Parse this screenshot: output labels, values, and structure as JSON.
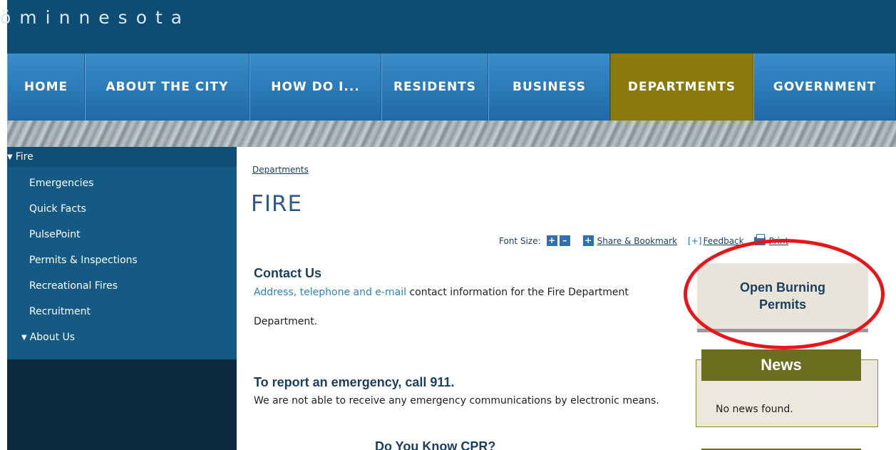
{
  "header": {
    "brand": "minnesota",
    "brand_prefix": "ö"
  },
  "nav": {
    "items": [
      {
        "label": "HOME"
      },
      {
        "label": "ABOUT THE CITY"
      },
      {
        "label": "HOW DO I..."
      },
      {
        "label": "RESIDENTS"
      },
      {
        "label": "BUSINESS"
      },
      {
        "label": "DEPARTMENTS"
      },
      {
        "label": "GOVERNMENT"
      }
    ],
    "active": "DEPARTMENTS"
  },
  "sidebar": {
    "header": "Fire",
    "items": [
      {
        "label": "Emergencies"
      },
      {
        "label": "Quick Facts"
      },
      {
        "label": "PulsePoint"
      },
      {
        "label": "Permits & Inspections"
      },
      {
        "label": "Recreational Fires"
      },
      {
        "label": "Recruitment"
      }
    ],
    "about": "About Us"
  },
  "content": {
    "breadcrumb": "Departments",
    "title": "FIRE",
    "toolbar": {
      "font_size_label": "Font Size:",
      "share": "Share & Bookmark",
      "feedback": "Feedback",
      "print": "Print"
    },
    "contact": {
      "heading": "Contact Us",
      "link": "Address, telephone and e-mail",
      "text": " contact information for the Fire Department",
      "text2": "Department."
    },
    "emergency": {
      "heading": "To report an emergency, call 911.",
      "text": "We are not able to receive any emergency communications by electronic means."
    },
    "cpr_heading": "Do You Know CPR?"
  },
  "right": {
    "burn_permits": "Open Burning Permits",
    "news_title": "News",
    "news_empty": "No news found."
  },
  "colors": {
    "header_bg": "#0e4d73",
    "nav_bg": "#2a7bbd",
    "nav_active": "#8a7a0d",
    "sidebar_bg": "#145a85",
    "title": "#2f5b85",
    "annotation": "#e8161a"
  }
}
